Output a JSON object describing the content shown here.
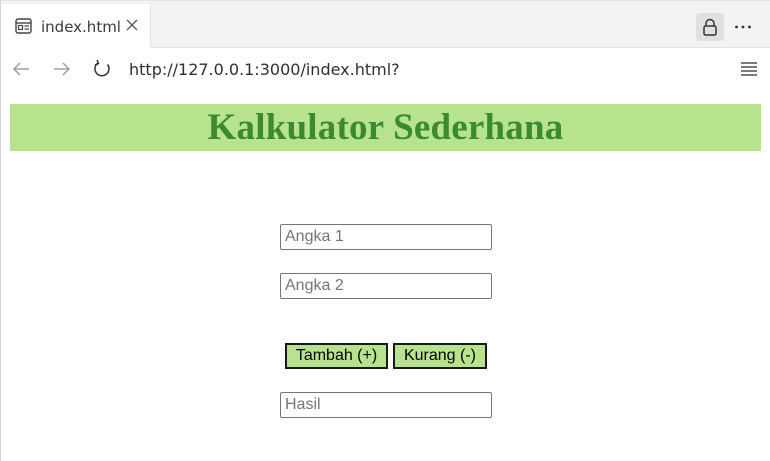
{
  "browser": {
    "tab_title": "index.html",
    "url": "http://127.0.0.1:3000/index.html?",
    "icons": {
      "tab": "page-icon",
      "close": "close-icon",
      "lock": "lock-icon",
      "more": "more-icon",
      "back": "back-arrow-icon",
      "forward": "forward-arrow-icon",
      "reload": "reload-icon",
      "menu": "menu-icon"
    }
  },
  "page": {
    "title": "Kalkulator Sederhana",
    "input1_placeholder": "Angka 1",
    "input2_placeholder": "Angka 2",
    "add_label": "Tambah (+)",
    "subtract_label": "Kurang (-)",
    "result_placeholder": "Hasil"
  },
  "colors": {
    "accent": "#b8e38e",
    "title_text": "#3b8a33"
  }
}
